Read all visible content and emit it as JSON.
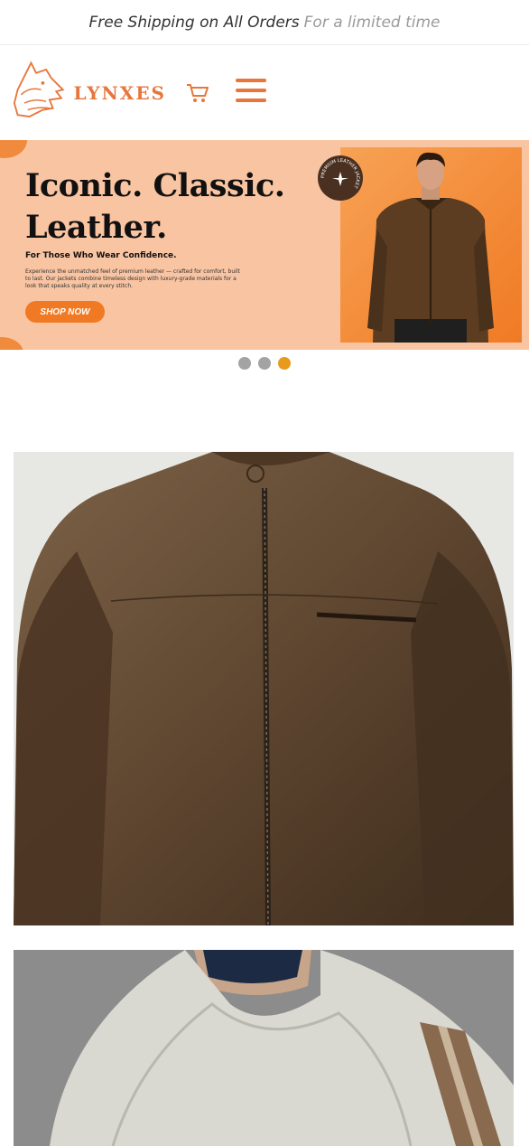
{
  "announcement": {
    "main": "Free Shipping on All Orders",
    "sub": "For a limited time"
  },
  "header": {
    "logo_text": "LYNXES",
    "logo_icon": "lynx-icon",
    "cart_icon": "cart-icon",
    "menu_icon": "hamburger-menu-icon"
  },
  "hero": {
    "title_line1": "Iconic. Classic.",
    "title_line2": "Leather.",
    "tagline": "For Those Who Wear Confidence.",
    "description": "Experience the unmatched feel of premium leather — crafted for comfort, built to last. Our jackets combine timeless design with luxury-grade materials for a look that speaks quality at every stitch.",
    "cta": "SHOP NOW",
    "badge_text": "PREMIUM LEATHER JACKET"
  },
  "carousel": {
    "slides": 3,
    "active_index": 2
  },
  "colors": {
    "accent": "#e8763b",
    "button": "#f07a24",
    "hero_bg": "#f9c4a2",
    "dot_active": "#e79a1c",
    "dot_inactive": "#a3a3a3"
  },
  "products": [
    {
      "image": "brown-leather-jacket"
    },
    {
      "image": "grey-wool-shawl"
    }
  ]
}
